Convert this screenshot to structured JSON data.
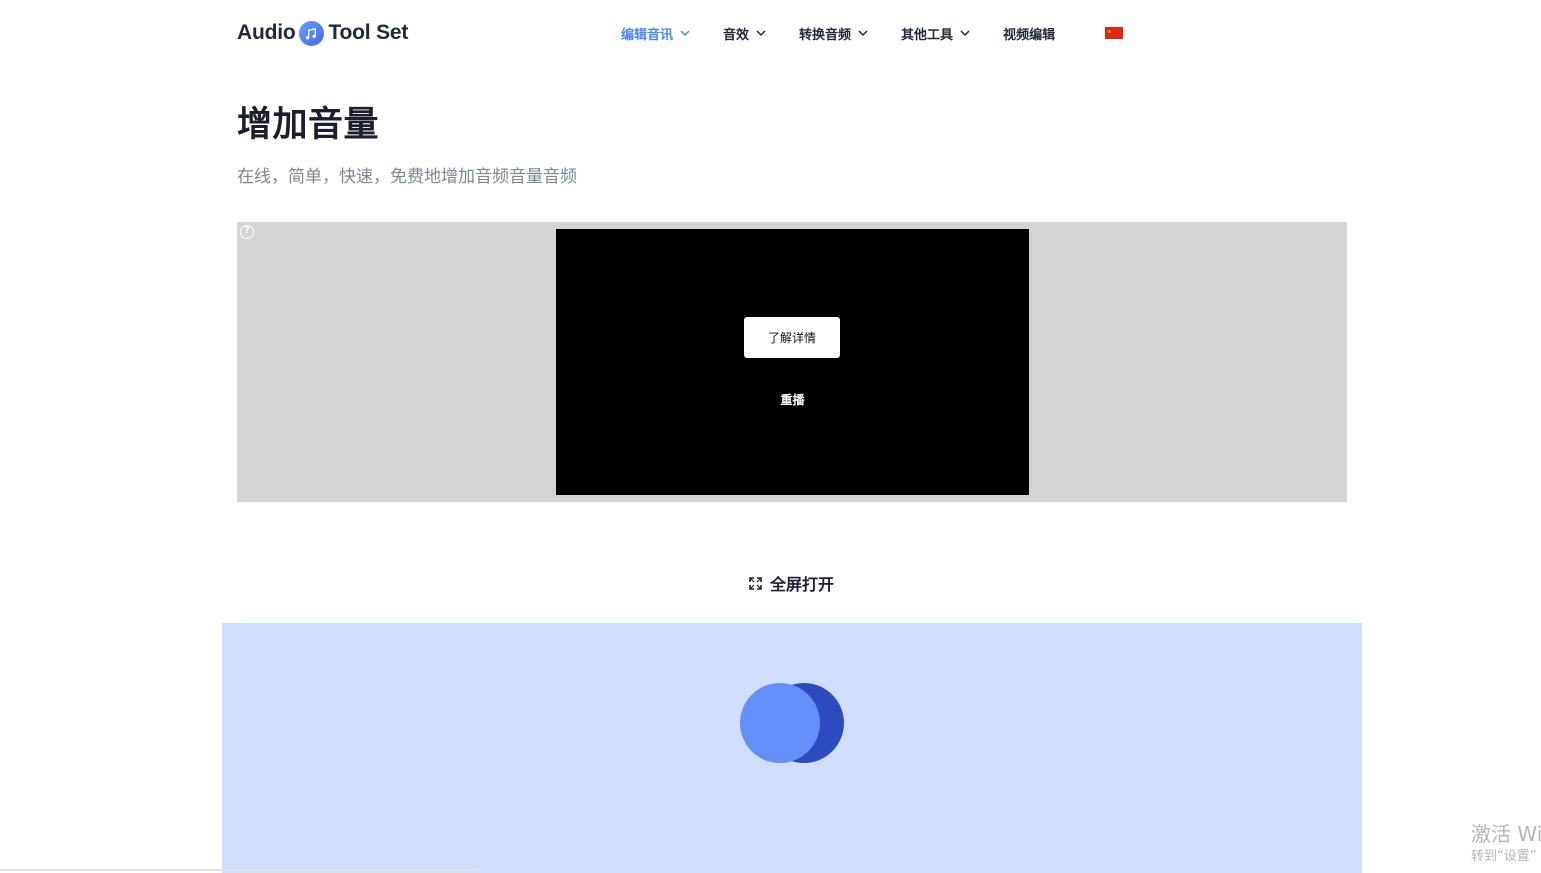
{
  "header": {
    "logo": {
      "left_text": "Audio",
      "right_text": "Tool Set",
      "icon": "music-note-icon"
    },
    "nav": [
      {
        "label": "编辑音讯",
        "has_dropdown": true,
        "active": true
      },
      {
        "label": "音效",
        "has_dropdown": true,
        "active": false
      },
      {
        "label": "转换音频",
        "has_dropdown": true,
        "active": false
      },
      {
        "label": "其他工具",
        "has_dropdown": true,
        "active": false
      },
      {
        "label": "视频编辑",
        "has_dropdown": false,
        "active": false
      }
    ],
    "language_flag": "china-flag-icon"
  },
  "main": {
    "title": "增加音量",
    "subtitle": "在线，简单，快速，免费地增加音频音量音频"
  },
  "ad": {
    "help_icon_text": "?",
    "learn_more_label": "了解详情",
    "replay_label": "重播"
  },
  "fullscreen": {
    "label": "全屏打开",
    "icon": "expand-icon"
  },
  "tool": {
    "loading_icon": "loading-spinner-icon"
  },
  "watermark": {
    "line1": "激活 Wi",
    "line2": "转到“设置”"
  },
  "colors": {
    "accent": "#4f86f7",
    "ad_background": "#d4d4d4",
    "tool_background": "#d0ddfc",
    "loader_front": "#638ff8",
    "loader_back": "#2c4bbf"
  }
}
